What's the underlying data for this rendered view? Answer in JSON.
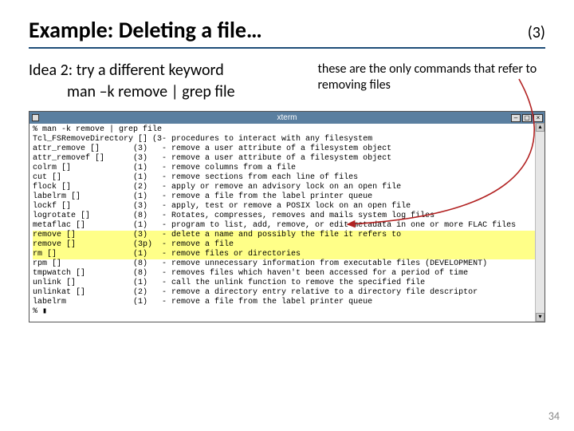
{
  "title": "Example: Deleting a file…",
  "slide_marker": "(3)",
  "idea": {
    "line1": "Idea 2: try a different keyword",
    "line2": "man –k remove | grep file"
  },
  "note": "these are the only commands that refer to removing files",
  "terminal": {
    "window_title": "xterm",
    "prompt_line": "% man -k remove | grep file",
    "rows": [
      {
        "name": "Tcl_FSRemoveDirectory [] (3)",
        "desc": "- procedures to interact with any filesystem"
      },
      {
        "name": "attr_remove []",
        "sec": "(3)",
        "desc": "- remove a user attribute of a filesystem object"
      },
      {
        "name": "attr_removef []",
        "sec": "(3)",
        "desc": "- remove a user attribute of a filesystem object"
      },
      {
        "name": "colrm []",
        "sec": "(1)",
        "desc": "- remove columns from a file"
      },
      {
        "name": "cut []",
        "sec": "(1)",
        "desc": "- remove sections from each line of files"
      },
      {
        "name": "flock []",
        "sec": "(2)",
        "desc": "- apply or remove an advisory lock on an open file"
      },
      {
        "name": "labelrm []",
        "sec": "(1)",
        "desc": "- remove a file from the label printer queue"
      },
      {
        "name": "lockf []",
        "sec": "(3)",
        "desc": "- apply, test or remove a POSIX lock on an open file"
      },
      {
        "name": "logrotate []",
        "sec": "(8)",
        "desc": "- Rotates, compresses, removes and mails system log files"
      },
      {
        "name": "metaflac []",
        "sec": "(1)",
        "desc": "- program to list, add, remove, or edit metadata in one or more FLAC files"
      },
      {
        "name": "remove []",
        "sec": "(3)",
        "desc": "- delete a name and possibly the file it refers to",
        "hl": true
      },
      {
        "name": "remove []",
        "sec": "(3p)",
        "desc": "- remove a file",
        "hl": true
      },
      {
        "name": "rm []",
        "sec": "(1)",
        "desc": "- remove files or directories",
        "hl": true
      },
      {
        "name": "rpm []",
        "sec": "(8)",
        "desc": "- remove unnecessary information from executable files (DEVELOPMENT)"
      },
      {
        "name": "tmpwatch []",
        "sec": "(8)",
        "desc": "- removes files which haven't been accessed for a period of time"
      },
      {
        "name": "unlink []",
        "sec": "(1)",
        "desc": "- call the unlink function to remove the specified file"
      },
      {
        "name": "unlinkat []",
        "sec": "(2)",
        "desc": "- remove a directory entry relative to a directory file descriptor"
      },
      {
        "name": "labelrm",
        "sec": "(1)",
        "desc": "- remove a file from the label printer queue"
      }
    ],
    "final_prompt": "% ▮"
  },
  "page_number": "34",
  "colors": {
    "accent": "#1f4e79",
    "highlight": "#ffff88",
    "titlebar": "#5a7fa0",
    "arrow": "#b22222"
  }
}
